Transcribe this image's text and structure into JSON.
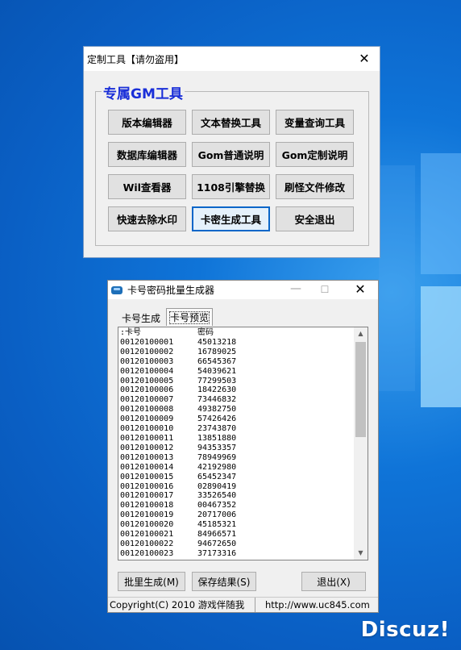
{
  "watermark": "Discuz!",
  "gm_window": {
    "title": "定制工具【请勿盗用】",
    "close_glyph": "✕",
    "group_title": "专属GM工具",
    "buttons": [
      "版本编辑器",
      "文本替换工具",
      "变量查询工具",
      "数据库编辑器",
      "Gom普通说明",
      "Gom定制说明",
      "Wil查看器",
      "1108引擎替换",
      "刷怪文件修改",
      "快速去除水印",
      "卡密生成工具",
      "安全退出"
    ]
  },
  "card_window": {
    "title": "卡号密码批量生成器",
    "min_glyph": "—",
    "max_glyph": "☐",
    "close_glyph": "✕",
    "tabs": [
      "卡号生成",
      "卡号预览"
    ],
    "active_tab": "卡号预览",
    "list_header": [
      ":卡号",
      "密码"
    ],
    "rows": [
      [
        "00120100001",
        "45013218"
      ],
      [
        "00120100002",
        "16789025"
      ],
      [
        "00120100003",
        "66545367"
      ],
      [
        "00120100004",
        "54039621"
      ],
      [
        "00120100005",
        "77299503"
      ],
      [
        "00120100006",
        "18422630"
      ],
      [
        "00120100007",
        "73446832"
      ],
      [
        "00120100008",
        "49382750"
      ],
      [
        "00120100009",
        "57426426"
      ],
      [
        "00120100010",
        "23743870"
      ],
      [
        "00120100011",
        "13851880"
      ],
      [
        "00120100012",
        "94353357"
      ],
      [
        "00120100013",
        "78949969"
      ],
      [
        "00120100014",
        "42192980"
      ],
      [
        "00120100015",
        "65452347"
      ],
      [
        "00120100016",
        "02890419"
      ],
      [
        "00120100017",
        "33526540"
      ],
      [
        "00120100018",
        "00467352"
      ],
      [
        "00120100019",
        "20717006"
      ],
      [
        "00120100020",
        "45185321"
      ],
      [
        "00120100021",
        "84966571"
      ],
      [
        "00120100022",
        "94672650"
      ],
      [
        "00120100023",
        "37173316"
      ]
    ],
    "buttons": {
      "batch": "批里生成(M)",
      "save": "保存结果(S)",
      "exit": "退出(X)"
    },
    "status": {
      "copyright": "Copyright(C) 2010 游戏伴随我",
      "url": "http://www.uc845.com"
    }
  }
}
